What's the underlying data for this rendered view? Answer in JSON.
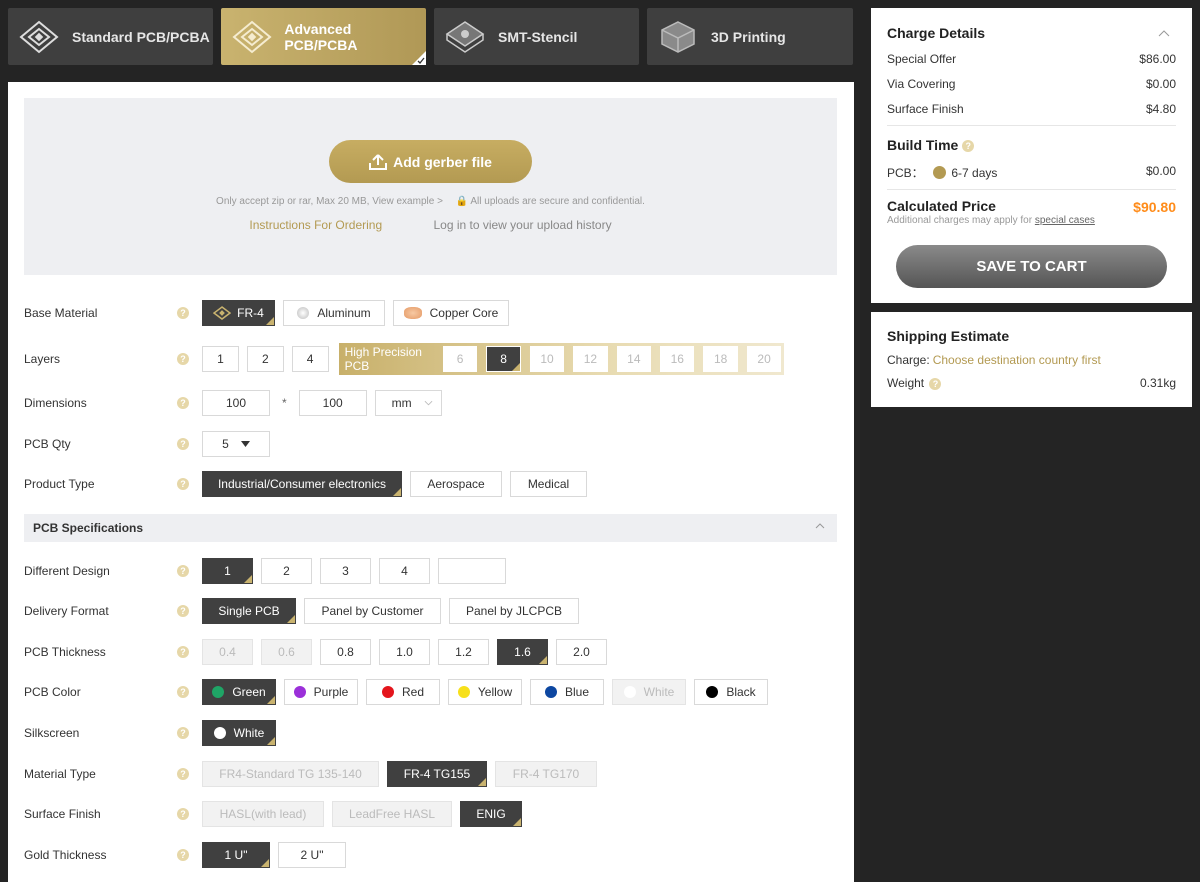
{
  "tabs": [
    {
      "label": "Standard PCB/PCBA",
      "icon": "pcb-chip-icon",
      "active": false
    },
    {
      "label": "Advanced PCB/PCBA",
      "icon": "advanced-pcb-icon",
      "active": true
    },
    {
      "label": "SMT-Stencil",
      "icon": "stencil-icon",
      "active": false
    },
    {
      "label": "3D Printing",
      "icon": "3d-printing-icon",
      "active": false
    }
  ],
  "upload": {
    "button_label": "Add gerber file",
    "note_left": "Only accept zip or rar, Max 20 MB, View example >",
    "note_right": "All uploads are secure and confidential.",
    "instructions_link": "Instructions For Ordering",
    "history_link": "Log in to view your upload history"
  },
  "form": {
    "base_material": {
      "label": "Base Material",
      "options": [
        "FR-4",
        "Aluminum",
        "Copper Core"
      ],
      "selected": "FR-4"
    },
    "layers": {
      "label": "Layers",
      "options": [
        "1",
        "2",
        "4"
      ],
      "high_precision_label": "High Precision PCB",
      "hp_options": [
        "6",
        "8",
        "10",
        "12",
        "14",
        "16",
        "18",
        "20"
      ],
      "selected": "8"
    },
    "dimensions": {
      "label": "Dimensions",
      "width": "100",
      "separator": "*",
      "height": "100",
      "unit": "mm"
    },
    "qty": {
      "label": "PCB Qty",
      "value": "5"
    },
    "product_type": {
      "label": "Product Type",
      "options": [
        "Industrial/Consumer electronics",
        "Aerospace",
        "Medical"
      ],
      "selected": "Industrial/Consumer electronics"
    }
  },
  "specs": {
    "section_title": "PCB Specifications",
    "different_design": {
      "label": "Different Design",
      "options": [
        "1",
        "2",
        "3",
        "4",
        ""
      ],
      "selected": "1"
    },
    "delivery_format": {
      "label": "Delivery Format",
      "options": [
        "Single PCB",
        "Panel by Customer",
        "Panel by JLCPCB"
      ],
      "selected": "Single PCB"
    },
    "thickness": {
      "label": "PCB Thickness",
      "options": [
        "0.4",
        "0.6",
        "0.8",
        "1.0",
        "1.2",
        "1.6",
        "2.0"
      ],
      "selected": "1.6",
      "disabled": [
        "0.4",
        "0.6"
      ]
    },
    "color": {
      "label": "PCB Color",
      "options": [
        {
          "name": "Green",
          "color": "#1fa566"
        },
        {
          "name": "Purple",
          "color": "#9b30d9"
        },
        {
          "name": "Red",
          "color": "#e4151c"
        },
        {
          "name": "Yellow",
          "color": "#f7e01a"
        },
        {
          "name": "Blue",
          "color": "#0d47a1"
        },
        {
          "name": "White",
          "color": "#ffffff"
        },
        {
          "name": "Black",
          "color": "#000000"
        }
      ],
      "selected": "Green",
      "disabled": [
        "White"
      ]
    },
    "silkscreen": {
      "label": "Silkscreen",
      "value": "White"
    },
    "material_type": {
      "label": "Material Type",
      "options": [
        "FR4-Standard TG 135-140",
        "FR-4 TG155",
        "FR-4 TG170"
      ],
      "selected": "FR-4 TG155",
      "disabled": [
        "FR4-Standard TG 135-140",
        "FR-4 TG170"
      ]
    },
    "surface_finish": {
      "label": "Surface Finish",
      "options": [
        "HASL(with lead)",
        "LeadFree HASL",
        "ENIG"
      ],
      "selected": "ENIG",
      "disabled": [
        "HASL(with lead)",
        "LeadFree HASL"
      ]
    },
    "gold_thickness": {
      "label": "Gold Thickness",
      "options": [
        "1 U\"",
        "2 U\""
      ],
      "selected": "1 U\""
    }
  },
  "charge": {
    "title": "Charge Details",
    "items": [
      {
        "label": "Special Offer",
        "value": "$86.00"
      },
      {
        "label": "Via Covering",
        "value": "$0.00"
      },
      {
        "label": "Surface Finish",
        "value": "$4.80"
      }
    ],
    "build_time_title": "Build Time",
    "build_time_label": "PCB：",
    "build_time_days": "6-7 days",
    "build_time_value": "$0.00",
    "calc_title": "Calculated Price",
    "calc_value": "$90.80",
    "calc_note": "Additional charges may apply for",
    "calc_note_link": "special cases",
    "save_button": "SAVE TO CART"
  },
  "shipping": {
    "title": "Shipping Estimate",
    "charge_label": "Charge:",
    "charge_value": "Choose destination country first",
    "weight_label": "Weight",
    "weight_value": "0.31kg"
  },
  "colors": {
    "gold": "#b39a52",
    "dark": "#404040",
    "price": "#ff8c1a"
  }
}
